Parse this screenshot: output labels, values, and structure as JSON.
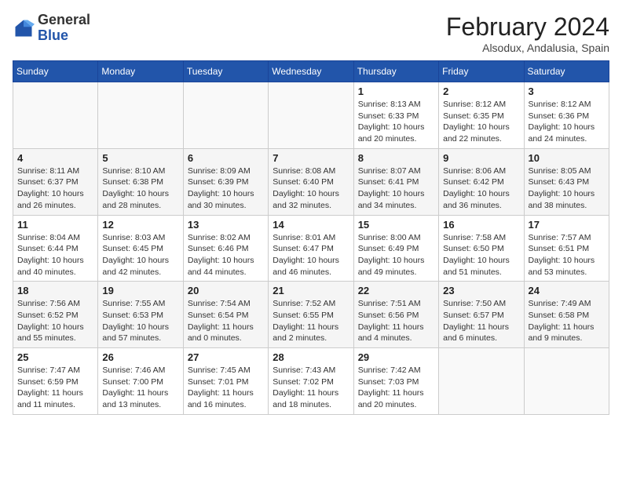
{
  "header": {
    "logo": {
      "general": "General",
      "blue": "Blue"
    },
    "title": "February 2024",
    "location": "Alsodux, Andalusia, Spain"
  },
  "weekdays": [
    "Sunday",
    "Monday",
    "Tuesday",
    "Wednesday",
    "Thursday",
    "Friday",
    "Saturday"
  ],
  "weeks": [
    [
      {
        "day": "",
        "info": ""
      },
      {
        "day": "",
        "info": ""
      },
      {
        "day": "",
        "info": ""
      },
      {
        "day": "",
        "info": ""
      },
      {
        "day": "1",
        "info": "Sunrise: 8:13 AM\nSunset: 6:33 PM\nDaylight: 10 hours\nand 20 minutes."
      },
      {
        "day": "2",
        "info": "Sunrise: 8:12 AM\nSunset: 6:35 PM\nDaylight: 10 hours\nand 22 minutes."
      },
      {
        "day": "3",
        "info": "Sunrise: 8:12 AM\nSunset: 6:36 PM\nDaylight: 10 hours\nand 24 minutes."
      }
    ],
    [
      {
        "day": "4",
        "info": "Sunrise: 8:11 AM\nSunset: 6:37 PM\nDaylight: 10 hours\nand 26 minutes."
      },
      {
        "day": "5",
        "info": "Sunrise: 8:10 AM\nSunset: 6:38 PM\nDaylight: 10 hours\nand 28 minutes."
      },
      {
        "day": "6",
        "info": "Sunrise: 8:09 AM\nSunset: 6:39 PM\nDaylight: 10 hours\nand 30 minutes."
      },
      {
        "day": "7",
        "info": "Sunrise: 8:08 AM\nSunset: 6:40 PM\nDaylight: 10 hours\nand 32 minutes."
      },
      {
        "day": "8",
        "info": "Sunrise: 8:07 AM\nSunset: 6:41 PM\nDaylight: 10 hours\nand 34 minutes."
      },
      {
        "day": "9",
        "info": "Sunrise: 8:06 AM\nSunset: 6:42 PM\nDaylight: 10 hours\nand 36 minutes."
      },
      {
        "day": "10",
        "info": "Sunrise: 8:05 AM\nSunset: 6:43 PM\nDaylight: 10 hours\nand 38 minutes."
      }
    ],
    [
      {
        "day": "11",
        "info": "Sunrise: 8:04 AM\nSunset: 6:44 PM\nDaylight: 10 hours\nand 40 minutes."
      },
      {
        "day": "12",
        "info": "Sunrise: 8:03 AM\nSunset: 6:45 PM\nDaylight: 10 hours\nand 42 minutes."
      },
      {
        "day": "13",
        "info": "Sunrise: 8:02 AM\nSunset: 6:46 PM\nDaylight: 10 hours\nand 44 minutes."
      },
      {
        "day": "14",
        "info": "Sunrise: 8:01 AM\nSunset: 6:47 PM\nDaylight: 10 hours\nand 46 minutes."
      },
      {
        "day": "15",
        "info": "Sunrise: 8:00 AM\nSunset: 6:49 PM\nDaylight: 10 hours\nand 49 minutes."
      },
      {
        "day": "16",
        "info": "Sunrise: 7:58 AM\nSunset: 6:50 PM\nDaylight: 10 hours\nand 51 minutes."
      },
      {
        "day": "17",
        "info": "Sunrise: 7:57 AM\nSunset: 6:51 PM\nDaylight: 10 hours\nand 53 minutes."
      }
    ],
    [
      {
        "day": "18",
        "info": "Sunrise: 7:56 AM\nSunset: 6:52 PM\nDaylight: 10 hours\nand 55 minutes."
      },
      {
        "day": "19",
        "info": "Sunrise: 7:55 AM\nSunset: 6:53 PM\nDaylight: 10 hours\nand 57 minutes."
      },
      {
        "day": "20",
        "info": "Sunrise: 7:54 AM\nSunset: 6:54 PM\nDaylight: 11 hours\nand 0 minutes."
      },
      {
        "day": "21",
        "info": "Sunrise: 7:52 AM\nSunset: 6:55 PM\nDaylight: 11 hours\nand 2 minutes."
      },
      {
        "day": "22",
        "info": "Sunrise: 7:51 AM\nSunset: 6:56 PM\nDaylight: 11 hours\nand 4 minutes."
      },
      {
        "day": "23",
        "info": "Sunrise: 7:50 AM\nSunset: 6:57 PM\nDaylight: 11 hours\nand 6 minutes."
      },
      {
        "day": "24",
        "info": "Sunrise: 7:49 AM\nSunset: 6:58 PM\nDaylight: 11 hours\nand 9 minutes."
      }
    ],
    [
      {
        "day": "25",
        "info": "Sunrise: 7:47 AM\nSunset: 6:59 PM\nDaylight: 11 hours\nand 11 minutes."
      },
      {
        "day": "26",
        "info": "Sunrise: 7:46 AM\nSunset: 7:00 PM\nDaylight: 11 hours\nand 13 minutes."
      },
      {
        "day": "27",
        "info": "Sunrise: 7:45 AM\nSunset: 7:01 PM\nDaylight: 11 hours\nand 16 minutes."
      },
      {
        "day": "28",
        "info": "Sunrise: 7:43 AM\nSunset: 7:02 PM\nDaylight: 11 hours\nand 18 minutes."
      },
      {
        "day": "29",
        "info": "Sunrise: 7:42 AM\nSunset: 7:03 PM\nDaylight: 11 hours\nand 20 minutes."
      },
      {
        "day": "",
        "info": ""
      },
      {
        "day": "",
        "info": ""
      }
    ]
  ]
}
